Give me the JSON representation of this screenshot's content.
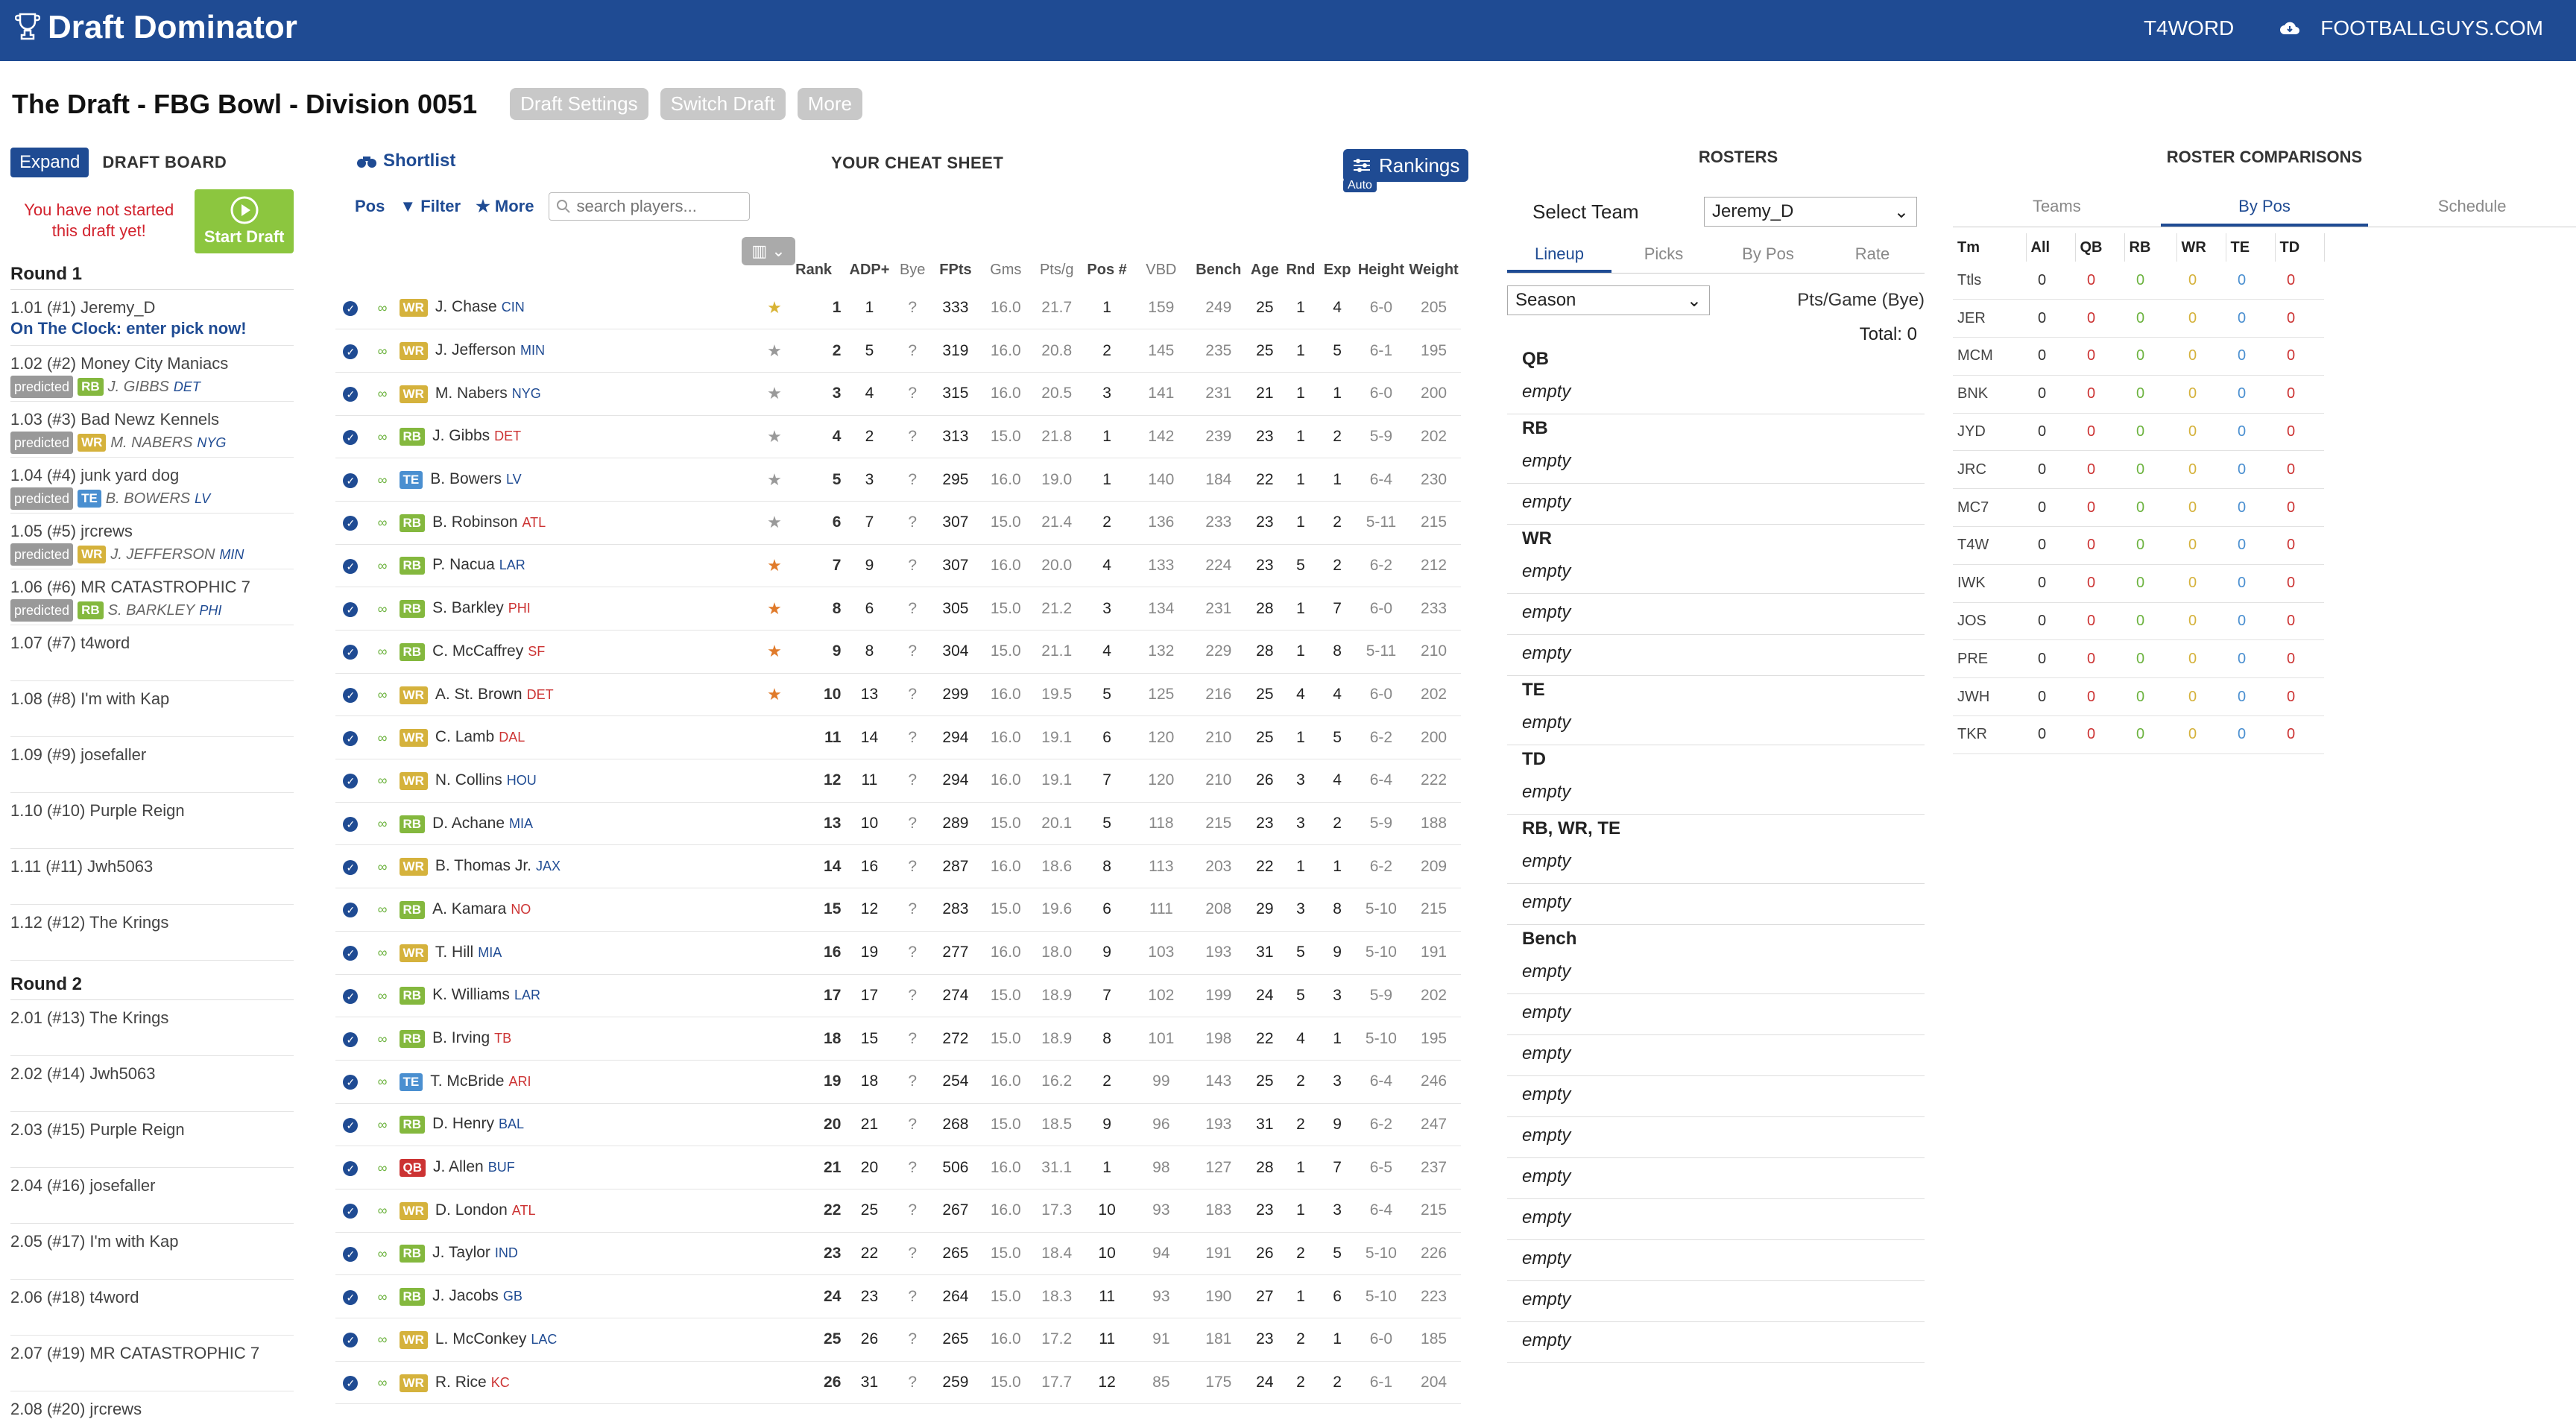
{
  "app": {
    "brand": "Draft Dominator",
    "user": "T4WORD",
    "site": "FOOTBALLGUYS.COM"
  },
  "draft": {
    "title": "The Draft - FBG Bowl - Division 0051",
    "buttons": [
      "Draft Settings",
      "Switch Draft",
      "More"
    ]
  },
  "board": {
    "expand": "Expand",
    "title": "DRAFT BOARD",
    "notice": "You have not started this draft yet!",
    "start": "Start Draft",
    "round1": "Round 1",
    "round2": "Round 2",
    "clock": "On The Clock: enter pick now!",
    "predicted": "predicted",
    "picks_r1": [
      {
        "label": "1.01 (#1) Jeremy_D",
        "pos": "",
        "player": "",
        "team": ""
      },
      {
        "label": "1.02 (#2) Money City Maniacs",
        "pos": "RB",
        "player": "J. GIBBS",
        "team": "DET"
      },
      {
        "label": "1.03 (#3) Bad Newz Kennels",
        "pos": "WR",
        "player": "M. NABERS",
        "team": "NYG"
      },
      {
        "label": "1.04 (#4) junk yard dog",
        "pos": "TE",
        "player": "B. BOWERS",
        "team": "LV"
      },
      {
        "label": "1.05 (#5) jrcrews",
        "pos": "WR",
        "player": "J. JEFFERSON",
        "team": "MIN"
      },
      {
        "label": "1.06 (#6) MR CATASTROPHIC 7",
        "pos": "RB",
        "player": "S. BARKLEY",
        "team": "PHI"
      },
      {
        "label": "1.07 (#7) t4word",
        "pos": "",
        "player": "",
        "team": ""
      },
      {
        "label": "1.08 (#8) I'm with Kap",
        "pos": "",
        "player": "",
        "team": ""
      },
      {
        "label": "1.09 (#9) josefaller",
        "pos": "",
        "player": "",
        "team": ""
      },
      {
        "label": "1.10 (#10) Purple Reign",
        "pos": "",
        "player": "",
        "team": ""
      },
      {
        "label": "1.11 (#11) Jwh5063",
        "pos": "",
        "player": "",
        "team": ""
      },
      {
        "label": "1.12 (#12) The Krings",
        "pos": "",
        "player": "",
        "team": ""
      }
    ],
    "picks_r2": [
      "2.01 (#13) The Krings",
      "2.02 (#14) Jwh5063",
      "2.03 (#15) Purple Reign",
      "2.04 (#16) josefaller",
      "2.05 (#17) I'm with Kap",
      "2.06 (#18) t4word",
      "2.07 (#19) MR CATASTROPHIC 7",
      "2.08 (#20) jrcrews"
    ]
  },
  "cheat": {
    "shortlist": "Shortlist",
    "title": "YOUR CHEAT SHEET",
    "rankings": "Rankings",
    "auto": "Auto",
    "pos": "Pos",
    "filter": "Filter",
    "more": "More",
    "search_placeholder": "search players...",
    "columns": [
      "Rank",
      "ADP+",
      "Bye",
      "FPts",
      "Gms",
      "Pts/g",
      "Pos #",
      "VBD",
      "Bench",
      "Age",
      "Rnd",
      "Exp",
      "Height",
      "Weight"
    ],
    "players": [
      {
        "pos": "WR",
        "name": "J. Chase",
        "team": "CIN",
        "rank": "1",
        "adp": "1",
        "bye": "?",
        "fpts": "333",
        "gms": "16.0",
        "ptsg": "21.7",
        "posn": "1",
        "vbd": "159",
        "bench": "249",
        "age": "25",
        "rnd": "1",
        "exp": "4",
        "ht": "6-0",
        "wt": "205",
        "star": "gold"
      },
      {
        "pos": "WR",
        "name": "J. Jefferson",
        "team": "MIN",
        "rank": "2",
        "adp": "5",
        "bye": "?",
        "fpts": "319",
        "gms": "16.0",
        "ptsg": "20.8",
        "posn": "2",
        "vbd": "145",
        "bench": "235",
        "age": "25",
        "rnd": "1",
        "exp": "5",
        "ht": "6-1",
        "wt": "195",
        "star": "gray"
      },
      {
        "pos": "WR",
        "name": "M. Nabers",
        "team": "NYG",
        "rank": "3",
        "adp": "4",
        "bye": "?",
        "fpts": "315",
        "gms": "16.0",
        "ptsg": "20.5",
        "posn": "3",
        "vbd": "141",
        "bench": "231",
        "age": "21",
        "rnd": "1",
        "exp": "1",
        "ht": "6-0",
        "wt": "200",
        "star": "gray"
      },
      {
        "pos": "RB",
        "name": "J. Gibbs",
        "team": "DET",
        "rank": "4",
        "adp": "2",
        "bye": "?",
        "fpts": "313",
        "gms": "15.0",
        "ptsg": "21.8",
        "posn": "1",
        "vbd": "142",
        "bench": "239",
        "age": "23",
        "rnd": "1",
        "exp": "2",
        "ht": "5-9",
        "wt": "202",
        "star": "gray"
      },
      {
        "pos": "TE",
        "name": "B. Bowers",
        "team": "LV",
        "rank": "5",
        "adp": "3",
        "bye": "?",
        "fpts": "295",
        "gms": "16.0",
        "ptsg": "19.0",
        "posn": "1",
        "vbd": "140",
        "bench": "184",
        "age": "22",
        "rnd": "1",
        "exp": "1",
        "ht": "6-4",
        "wt": "230",
        "star": "gray"
      },
      {
        "pos": "RB",
        "name": "B. Robinson",
        "team": "ATL",
        "rank": "6",
        "adp": "7",
        "bye": "?",
        "fpts": "307",
        "gms": "15.0",
        "ptsg": "21.4",
        "posn": "2",
        "vbd": "136",
        "bench": "233",
        "age": "23",
        "rnd": "1",
        "exp": "2",
        "ht": "5-11",
        "wt": "215",
        "star": "gray"
      },
      {
        "pos": "RB",
        "name": "P. Nacua",
        "team": "LAR",
        "rank": "7",
        "adp": "9",
        "bye": "?",
        "fpts": "307",
        "gms": "16.0",
        "ptsg": "20.0",
        "posn": "4",
        "vbd": "133",
        "bench": "224",
        "age": "23",
        "rnd": "5",
        "exp": "2",
        "ht": "6-2",
        "wt": "212",
        "star": "hot"
      },
      {
        "pos": "RB",
        "name": "S. Barkley",
        "team": "PHI",
        "rank": "8",
        "adp": "6",
        "bye": "?",
        "fpts": "305",
        "gms": "15.0",
        "ptsg": "21.2",
        "posn": "3",
        "vbd": "134",
        "bench": "231",
        "age": "28",
        "rnd": "1",
        "exp": "7",
        "ht": "6-0",
        "wt": "233",
        "star": "hot"
      },
      {
        "pos": "RB",
        "name": "C. McCaffrey",
        "team": "SF",
        "rank": "9",
        "adp": "8",
        "bye": "?",
        "fpts": "304",
        "gms": "15.0",
        "ptsg": "21.1",
        "posn": "4",
        "vbd": "132",
        "bench": "229",
        "age": "28",
        "rnd": "1",
        "exp": "8",
        "ht": "5-11",
        "wt": "210",
        "star": "hot"
      },
      {
        "pos": "WR",
        "name": "A. St. Brown",
        "team": "DET",
        "rank": "10",
        "adp": "13",
        "bye": "?",
        "fpts": "299",
        "gms": "16.0",
        "ptsg": "19.5",
        "posn": "5",
        "vbd": "125",
        "bench": "216",
        "age": "25",
        "rnd": "4",
        "exp": "4",
        "ht": "6-0",
        "wt": "202",
        "star": "hot"
      },
      {
        "pos": "WR",
        "name": "C. Lamb",
        "team": "DAL",
        "rank": "11",
        "adp": "14",
        "bye": "?",
        "fpts": "294",
        "gms": "16.0",
        "ptsg": "19.1",
        "posn": "6",
        "vbd": "120",
        "bench": "210",
        "age": "25",
        "rnd": "1",
        "exp": "5",
        "ht": "6-2",
        "wt": "200",
        "star": ""
      },
      {
        "pos": "WR",
        "name": "N. Collins",
        "team": "HOU",
        "rank": "12",
        "adp": "11",
        "bye": "?",
        "fpts": "294",
        "gms": "16.0",
        "ptsg": "19.1",
        "posn": "7",
        "vbd": "120",
        "bench": "210",
        "age": "26",
        "rnd": "3",
        "exp": "4",
        "ht": "6-4",
        "wt": "222",
        "star": ""
      },
      {
        "pos": "RB",
        "name": "D. Achane",
        "team": "MIA",
        "rank": "13",
        "adp": "10",
        "bye": "?",
        "fpts": "289",
        "gms": "15.0",
        "ptsg": "20.1",
        "posn": "5",
        "vbd": "118",
        "bench": "215",
        "age": "23",
        "rnd": "3",
        "exp": "2",
        "ht": "5-9",
        "wt": "188",
        "star": ""
      },
      {
        "pos": "WR",
        "name": "B. Thomas Jr.",
        "team": "JAX",
        "rank": "14",
        "adp": "16",
        "bye": "?",
        "fpts": "287",
        "gms": "16.0",
        "ptsg": "18.6",
        "posn": "8",
        "vbd": "113",
        "bench": "203",
        "age": "22",
        "rnd": "1",
        "exp": "1",
        "ht": "6-2",
        "wt": "209",
        "star": ""
      },
      {
        "pos": "RB",
        "name": "A. Kamara",
        "team": "NO",
        "rank": "15",
        "adp": "12",
        "bye": "?",
        "fpts": "283",
        "gms": "15.0",
        "ptsg": "19.6",
        "posn": "6",
        "vbd": "111",
        "bench": "208",
        "age": "29",
        "rnd": "3",
        "exp": "8",
        "ht": "5-10",
        "wt": "215",
        "star": ""
      },
      {
        "pos": "WR",
        "name": "T. Hill",
        "team": "MIA",
        "rank": "16",
        "adp": "19",
        "bye": "?",
        "fpts": "277",
        "gms": "16.0",
        "ptsg": "18.0",
        "posn": "9",
        "vbd": "103",
        "bench": "193",
        "age": "31",
        "rnd": "5",
        "exp": "9",
        "ht": "5-10",
        "wt": "191",
        "star": ""
      },
      {
        "pos": "RB",
        "name": "K. Williams",
        "team": "LAR",
        "rank": "17",
        "adp": "17",
        "bye": "?",
        "fpts": "274",
        "gms": "15.0",
        "ptsg": "18.9",
        "posn": "7",
        "vbd": "102",
        "bench": "199",
        "age": "24",
        "rnd": "5",
        "exp": "3",
        "ht": "5-9",
        "wt": "202",
        "star": ""
      },
      {
        "pos": "RB",
        "name": "B. Irving",
        "team": "TB",
        "rank": "18",
        "adp": "15",
        "bye": "?",
        "fpts": "272",
        "gms": "15.0",
        "ptsg": "18.9",
        "posn": "8",
        "vbd": "101",
        "bench": "198",
        "age": "22",
        "rnd": "4",
        "exp": "1",
        "ht": "5-10",
        "wt": "195",
        "star": ""
      },
      {
        "pos": "TE",
        "name": "T. McBride",
        "team": "ARI",
        "rank": "19",
        "adp": "18",
        "bye": "?",
        "fpts": "254",
        "gms": "16.0",
        "ptsg": "16.2",
        "posn": "2",
        "vbd": "99",
        "bench": "143",
        "age": "25",
        "rnd": "2",
        "exp": "3",
        "ht": "6-4",
        "wt": "246",
        "star": ""
      },
      {
        "pos": "RB",
        "name": "D. Henry",
        "team": "BAL",
        "rank": "20",
        "adp": "21",
        "bye": "?",
        "fpts": "268",
        "gms": "15.0",
        "ptsg": "18.5",
        "posn": "9",
        "vbd": "96",
        "bench": "193",
        "age": "31",
        "rnd": "2",
        "exp": "9",
        "ht": "6-2",
        "wt": "247",
        "star": ""
      },
      {
        "pos": "QB",
        "name": "J. Allen",
        "team": "BUF",
        "rank": "21",
        "adp": "20",
        "bye": "?",
        "fpts": "506",
        "gms": "16.0",
        "ptsg": "31.1",
        "posn": "1",
        "vbd": "98",
        "bench": "127",
        "age": "28",
        "rnd": "1",
        "exp": "7",
        "ht": "6-5",
        "wt": "237",
        "star": ""
      },
      {
        "pos": "WR",
        "name": "D. London",
        "team": "ATL",
        "rank": "22",
        "adp": "25",
        "bye": "?",
        "fpts": "267",
        "gms": "16.0",
        "ptsg": "17.3",
        "posn": "10",
        "vbd": "93",
        "bench": "183",
        "age": "23",
        "rnd": "1",
        "exp": "3",
        "ht": "6-4",
        "wt": "215",
        "star": ""
      },
      {
        "pos": "RB",
        "name": "J. Taylor",
        "team": "IND",
        "rank": "23",
        "adp": "22",
        "bye": "?",
        "fpts": "265",
        "gms": "15.0",
        "ptsg": "18.4",
        "posn": "10",
        "vbd": "94",
        "bench": "191",
        "age": "26",
        "rnd": "2",
        "exp": "5",
        "ht": "5-10",
        "wt": "226",
        "star": ""
      },
      {
        "pos": "RB",
        "name": "J. Jacobs",
        "team": "GB",
        "rank": "24",
        "adp": "23",
        "bye": "?",
        "fpts": "264",
        "gms": "15.0",
        "ptsg": "18.3",
        "posn": "11",
        "vbd": "93",
        "bench": "190",
        "age": "27",
        "rnd": "1",
        "exp": "6",
        "ht": "5-10",
        "wt": "223",
        "star": ""
      },
      {
        "pos": "WR",
        "name": "L. McConkey",
        "team": "LAC",
        "rank": "25",
        "adp": "26",
        "bye": "?",
        "fpts": "265",
        "gms": "16.0",
        "ptsg": "17.2",
        "posn": "11",
        "vbd": "91",
        "bench": "181",
        "age": "23",
        "rnd": "2",
        "exp": "1",
        "ht": "6-0",
        "wt": "185",
        "star": ""
      },
      {
        "pos": "WR",
        "name": "R. Rice",
        "team": "KC",
        "rank": "26",
        "adp": "31",
        "bye": "?",
        "fpts": "259",
        "gms": "15.0",
        "ptsg": "17.7",
        "posn": "12",
        "vbd": "85",
        "bench": "175",
        "age": "24",
        "rnd": "2",
        "exp": "2",
        "ht": "6-1",
        "wt": "204",
        "star": ""
      }
    ]
  },
  "rosters": {
    "title": "ROSTERS",
    "select_label": "Select Team",
    "team": "Jeremy_D",
    "tabs": [
      "Lineup",
      "Picks",
      "By Pos",
      "Rate"
    ],
    "period": "Season",
    "ppg": "Pts/Game (Bye)",
    "total": "Total: 0",
    "empty": "empty",
    "slots": [
      {
        "head": "QB",
        "empties": 1
      },
      {
        "head": "RB",
        "empties": 2
      },
      {
        "head": "WR",
        "empties": 3
      },
      {
        "head": "TE",
        "empties": 1
      },
      {
        "head": "TD",
        "empties": 1
      },
      {
        "head": "RB, WR, TE",
        "empties": 2
      },
      {
        "head": "Bench",
        "empties": 10
      }
    ]
  },
  "comparisons": {
    "title": "ROSTER COMPARISONS",
    "tabs": [
      "Teams",
      "By Pos",
      "Schedule"
    ],
    "columns": [
      "Tm",
      "All",
      "QB",
      "RB",
      "WR",
      "TE",
      "TD"
    ],
    "teams": [
      "Ttls",
      "JER",
      "MCM",
      "BNK",
      "JYD",
      "JRC",
      "MC7",
      "T4W",
      "IWK",
      "JOS",
      "PRE",
      "JWH",
      "TKR"
    ],
    "value": "0"
  },
  "colors": {
    "brand": "#1f4b93",
    "wr": "#d5b23c",
    "rb": "#84b83e",
    "te": "#4a8fd0",
    "qb": "#cc3333",
    "start": "#8cc63f"
  }
}
